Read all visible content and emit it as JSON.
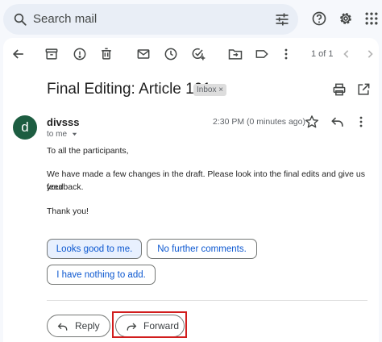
{
  "search": {
    "placeholder": "Search mail"
  },
  "toolbar": {
    "count": "1 of 1"
  },
  "email": {
    "subject": "Final Editing: Article 101",
    "label": "Inbox ×",
    "sender": "divsss",
    "avatar_letter": "d",
    "recipient": "to me",
    "time": "2:30 PM (0 minutes ago)",
    "body": [
      "To all the participants,",
      "We have made a few changes in the draft. Please look into the final edits and give us your",
      "feedback.",
      "Thank you!"
    ]
  },
  "smart_replies": [
    "Looks good to me.",
    "No further comments.",
    "I have nothing to add."
  ],
  "actions": {
    "reply": "Reply",
    "forward": "Forward"
  },
  "colors": {
    "avatar": "#1d5d41",
    "highlight": "#d11d1d",
    "accent": "#0b57d0"
  },
  "icons": [
    "search-icon",
    "filter-icon",
    "help-icon",
    "settings-icon",
    "apps-icon",
    "back-icon",
    "archive-icon",
    "report-spam-icon",
    "delete-icon",
    "mark-unread-icon",
    "snooze-icon",
    "add-task-icon",
    "move-to-icon",
    "label-icon",
    "more-icon",
    "prev-icon",
    "next-icon",
    "print-icon",
    "open-new-window-icon",
    "star-icon",
    "reply-icon",
    "forward-icon"
  ]
}
